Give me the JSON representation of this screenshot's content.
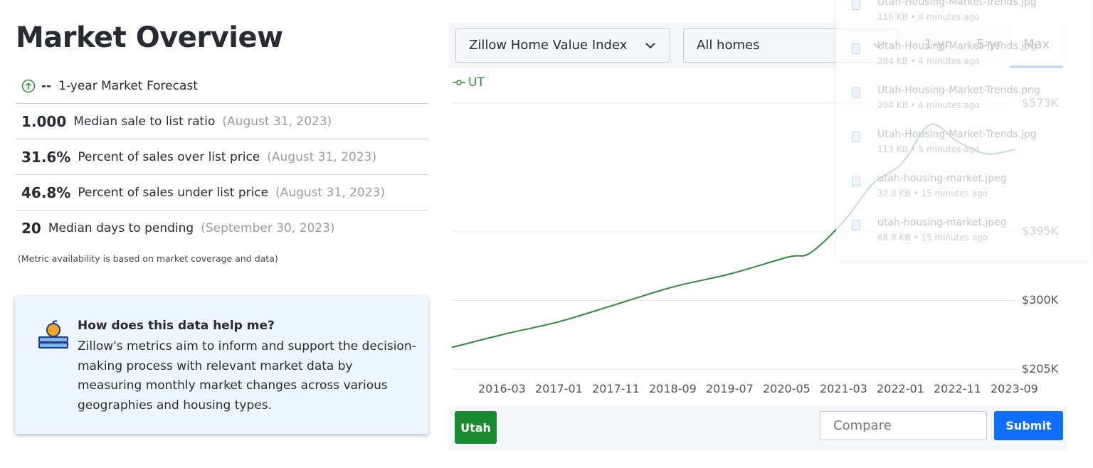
{
  "title": "Market Overview",
  "forecast": {
    "value": "--",
    "label": "1-year Market Forecast"
  },
  "metrics": [
    {
      "value": "1.000",
      "label": "Median sale to list ratio",
      "date": "(August 31, 2023)"
    },
    {
      "value": "31.6%",
      "label": "Percent of sales over list price",
      "date": "(August 31, 2023)"
    },
    {
      "value": "46.8%",
      "label": "Percent of sales under list price",
      "date": "(August 31, 2023)"
    },
    {
      "value": "20",
      "label": "Median days to pending",
      "date": "(September 30, 2023)"
    }
  ],
  "note": "(Metric availability is based on market coverage and data)",
  "card": {
    "title": "How does this data help me?",
    "body": "Zillow's metrics aim to inform and support the decision-making process with relevant market data by measuring monthly market changes across various geographies and housing types."
  },
  "controls": {
    "metric": "Zillow Home Value Index",
    "home_type": "All homes",
    "tabs": [
      "1-yr",
      "5-yr",
      "Max"
    ],
    "active_tab": "Max"
  },
  "bottom": {
    "region": "Utah",
    "compare_placeholder": "Compare",
    "submit": "Submit"
  },
  "colors": {
    "line": "#2e8b3a",
    "accent": "#0f6efd",
    "region": "#1a8a2e"
  },
  "chart_data": {
    "type": "line",
    "legend": "UT",
    "y_ticks": [
      "$573K",
      "$395K",
      "$300K",
      "$205K"
    ],
    "y_tick_values": [
      573,
      395,
      300,
      205
    ],
    "x_ticks": [
      "2016-03",
      "2017-01",
      "2017-11",
      "2018-09",
      "2019-07",
      "2020-05",
      "2021-03",
      "2022-01",
      "2022-11",
      "2023-09"
    ],
    "series": [
      {
        "name": "UT",
        "x": [
          "2015-06",
          "2016-03",
          "2017-01",
          "2017-11",
          "2018-09",
          "2019-07",
          "2020-05",
          "2020-09",
          "2021-03",
          "2021-08",
          "2022-01",
          "2022-06",
          "2022-11",
          "2023-04",
          "2023-09"
        ],
        "y": [
          235,
          253,
          271,
          295,
          319,
          337,
          360,
          366,
          411,
          462,
          489,
          543,
          519,
          503,
          509
        ]
      }
    ],
    "units": "thousands USD",
    "grid": true
  },
  "downloads": [
    {
      "name": "Utah-Housing-Market-Trends.jpg",
      "meta": "116 KB • 4 minutes ago"
    },
    {
      "name": "Utah-Housing-Market-Trends.jpg",
      "meta": "284 KB • 4 minutes ago"
    },
    {
      "name": "Utah-Housing-Market-Trends.png",
      "meta": "204 KB • 4 minutes ago"
    },
    {
      "name": "Utah-Housing-Market-Trends.jpg",
      "meta": "113 KB • 5 minutes ago"
    },
    {
      "name": "utah-housing-market.jpeg",
      "meta": "32.8 KB • 15 minutes ago"
    },
    {
      "name": "utah-housing-market.jpeg",
      "meta": "68.8 KB • 15 minutes ago"
    }
  ]
}
